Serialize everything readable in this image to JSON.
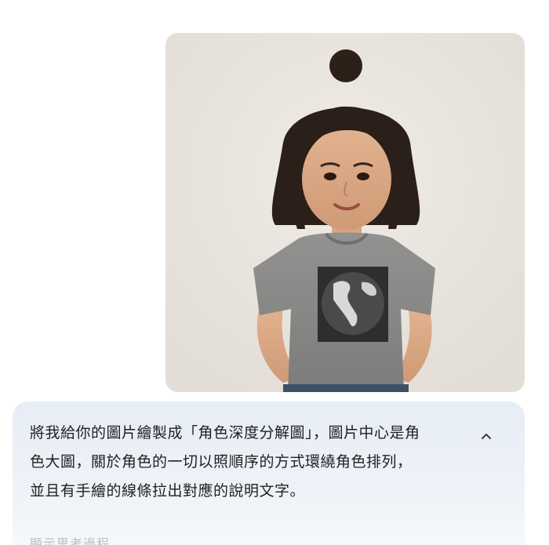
{
  "prompt": {
    "text": "將我給你的圖片繪製成「角色深度分解圖」，圖片中心是角\n色大圖，關於角色的一切以照順序的方式環繞角色排列，\n並且有手繪的線條拉出對應的說明文字。",
    "collapse_icon": "chevron-up-icon"
  },
  "next_message": {
    "partial_text": "顯示思考過程"
  },
  "image": {
    "subject": "girl-in-globe-tshirt",
    "background_color": "#e9e4dd",
    "shirt_color": "#8a8a88",
    "hair_color": "#2a1e18"
  }
}
